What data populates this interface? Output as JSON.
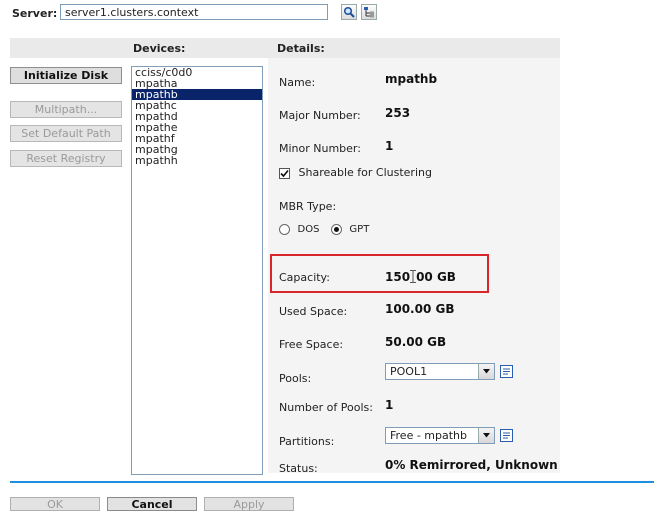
{
  "server": {
    "label": "Server:",
    "value": "server1.clusters.context"
  },
  "columns": {
    "devices": "Devices:",
    "details": "Details:"
  },
  "side_buttons": [
    {
      "label": "Initialize Disk",
      "enabled": true
    },
    {
      "label": "Multipath...",
      "enabled": false
    },
    {
      "label": "Set Default Path",
      "enabled": false
    },
    {
      "label": "Reset Registry",
      "enabled": false
    }
  ],
  "devices": [
    "cciss/c0d0",
    "mpatha",
    "mpathb",
    "mpathc",
    "mpathd",
    "mpathe",
    "mpathf",
    "mpathg",
    "mpathh"
  ],
  "selected_device": "mpathb",
  "details": {
    "name_label": "Name:",
    "name_value": "mpathb",
    "major_label": "Major Number:",
    "major_value": "253",
    "minor_label": "Minor Number:",
    "minor_value": "1",
    "shareable_label": "Shareable for Clustering",
    "shareable_checked": true,
    "mbr_label": "MBR Type:",
    "mbr_options": [
      "DOS",
      "GPT"
    ],
    "mbr_selected": "GPT",
    "capacity_label": "Capacity:",
    "capacity_value_a": "150",
    "capacity_value_b": "00 GB",
    "used_label": "Used Space:",
    "used_value": "100.00 GB",
    "free_label": "Free Space:",
    "free_value": "50.00 GB",
    "pools_label": "Pools:",
    "pools_value": "POOL1",
    "num_pools_label": "Number of Pools:",
    "num_pools_value": "1",
    "partitions_label": "Partitions:",
    "partitions_value": "Free - mpathb",
    "status_label": "Status:",
    "status_value": "0% Remirrored, Unknown"
  },
  "bottom_buttons": [
    {
      "label": "OK",
      "enabled": false
    },
    {
      "label": "Cancel",
      "enabled": true
    },
    {
      "label": "Apply",
      "enabled": false
    }
  ],
  "colors": {
    "highlight_box": "#d9262b",
    "selection": "#0a246a",
    "rule": "#1f8ee0"
  }
}
